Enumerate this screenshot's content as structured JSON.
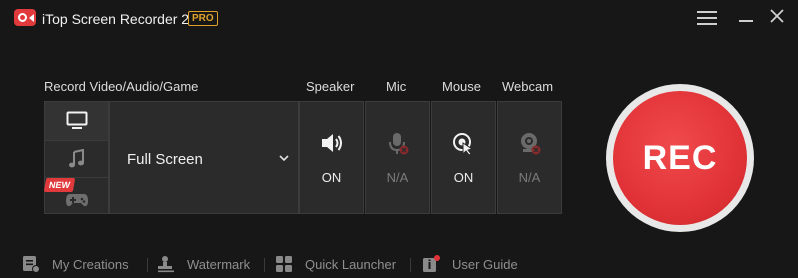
{
  "app": {
    "title": "iTop Screen Recorder 2",
    "badge": "PRO"
  },
  "labels": {
    "record": "Record Video/Audio/Game",
    "speaker": "Speaker",
    "mic": "Mic",
    "mouse": "Mouse",
    "webcam": "Webcam"
  },
  "modes": {
    "active": "screen",
    "items": [
      {
        "icon": "monitor-icon"
      },
      {
        "icon": "music-note-icon"
      },
      {
        "icon": "gamepad-icon",
        "badge": "NEW"
      }
    ]
  },
  "capture": {
    "selected": "Full Screen"
  },
  "devices": {
    "speaker": {
      "state": "ON",
      "icon": "speaker-icon"
    },
    "mic": {
      "state": "N/A",
      "icon": "microphone-icon"
    },
    "mouse": {
      "state": "ON",
      "icon": "mouse-click-icon"
    },
    "webcam": {
      "state": "N/A",
      "icon": "webcam-icon"
    }
  },
  "rec": {
    "label": "REC"
  },
  "footer": {
    "items": [
      {
        "label": "My Creations",
        "icon": "creations-icon"
      },
      {
        "label": "Watermark",
        "icon": "watermark-icon"
      },
      {
        "label": "Quick Launcher",
        "icon": "launcher-icon"
      },
      {
        "label": "User Guide",
        "icon": "user-guide-icon"
      }
    ]
  },
  "colors": {
    "background": "#171717",
    "panel": "#2b2b2b",
    "accent_red": "#e13337",
    "pro_gold": "#e0a12a",
    "disabled": "#7b7b7b"
  }
}
